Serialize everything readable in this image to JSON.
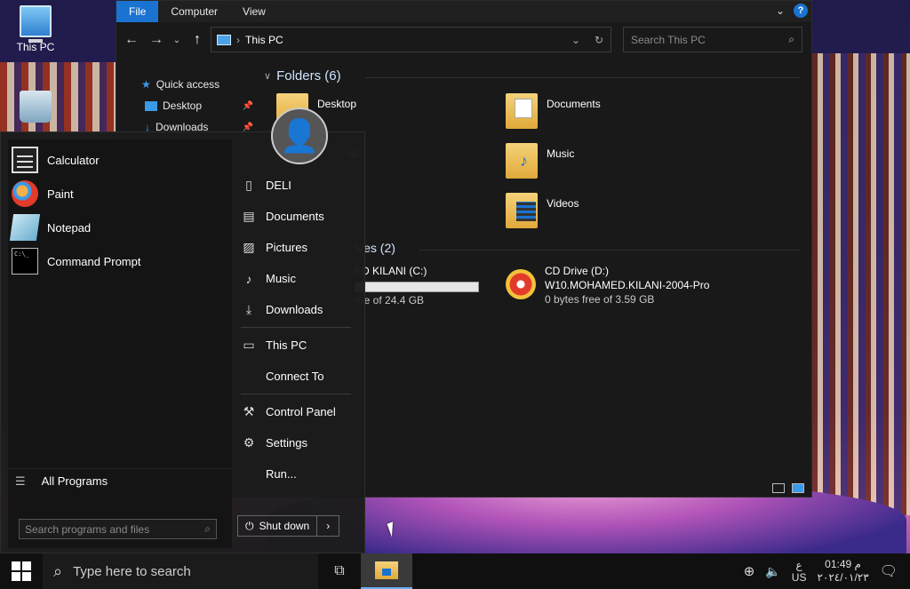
{
  "desktop": {
    "icons": [
      {
        "label": "This PC"
      }
    ]
  },
  "explorer": {
    "ribbon_tabs": [
      "File",
      "Computer",
      "View"
    ],
    "help_label": "?",
    "address": "This PC",
    "search_placeholder": "Search This PC",
    "nav": {
      "quick_access": "Quick access",
      "items": [
        {
          "label": "Desktop"
        },
        {
          "label": "Downloads"
        }
      ]
    },
    "folders_header": "Folders (6)",
    "folders": [
      {
        "name": "Desktop"
      },
      {
        "name": "Documents"
      },
      {
        "name": "ds"
      },
      {
        "name": "Music"
      },
      {
        "name": "Videos"
      }
    ],
    "drives_header": "ives (2)",
    "drives": [
      {
        "name": "ED KILANI (C:)",
        "free": "ree of 24.4 GB",
        "used_fraction": 0.0
      },
      {
        "name": "CD Drive (D:)",
        "line2": "W10.MOHAMED.KILANI-2004-Pro",
        "free": "0 bytes free of 3.59 GB"
      }
    ]
  },
  "start_menu": {
    "programs": [
      {
        "label": "Calculator"
      },
      {
        "label": "Paint"
      },
      {
        "label": "Notepad"
      },
      {
        "label": "Command Prompt",
        "icon_text": "C:\\_"
      }
    ],
    "all_programs": "All Programs",
    "search_placeholder": "Search programs and files",
    "right_items": [
      {
        "label": "DELI"
      },
      {
        "label": "Documents"
      },
      {
        "label": "Pictures"
      },
      {
        "label": "Music"
      },
      {
        "label": "Downloads"
      },
      {
        "label": "This PC"
      },
      {
        "label": "Connect To"
      },
      {
        "label": "Control Panel"
      },
      {
        "label": "Settings"
      },
      {
        "label": "Run..."
      }
    ],
    "shutdown": "Shut down"
  },
  "taskbar": {
    "search_placeholder": "Type here to search",
    "lang_top": "ع",
    "lang_bottom": "US",
    "time": "01:49 م",
    "date": "٢٠٢٤/٠١/٢٣"
  }
}
